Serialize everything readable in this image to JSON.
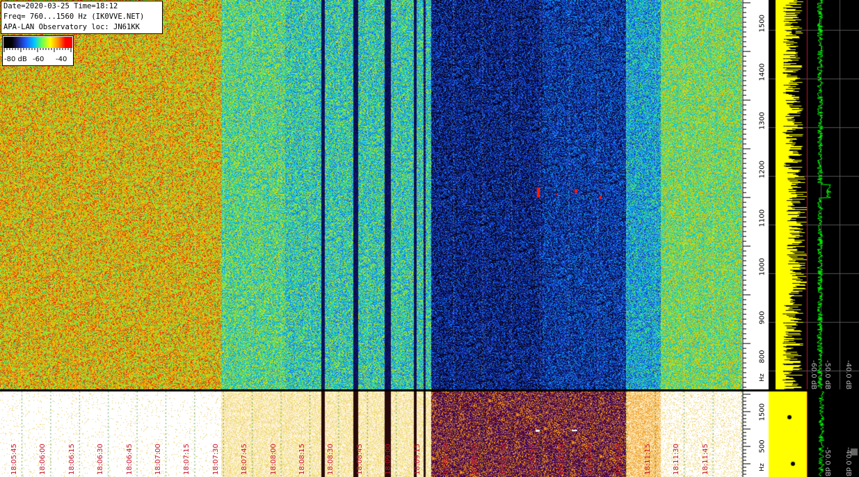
{
  "info": {
    "line1": "Date=2020-03-25 Time=18:12",
    "line2": "Freq= 760...1560 Hz (IK0VVE.NET)",
    "line3": "APA-LAN Observatory loc: JN61KK"
  },
  "colorbar": {
    "labels": [
      "-80 dB",
      "-60",
      "-40"
    ]
  },
  "freq_axis": {
    "unit": "Hz",
    "ticks": [
      "1500",
      "1400",
      "1300",
      "1200",
      "1100",
      "1000",
      "900",
      "800"
    ]
  },
  "lower_freq_axis": {
    "ticks": [
      "1500",
      "500"
    ],
    "unit": "Hz"
  },
  "spectrum": {
    "labels": [
      "-60.0 dB",
      "-50.0 dB",
      "-40.0 dB"
    ],
    "lower_labels": [
      "-50.0 dB",
      "-40.0 dB"
    ]
  },
  "time_axis": {
    "labels": [
      "18:05:45",
      "18:06:00",
      "18:06:15",
      "18:06:30",
      "18:06:45",
      "18:07:00",
      "18:07:15",
      "18:07:30",
      "18:07:45",
      "18:08:00",
      "18:08:15",
      "18:08:30",
      "18:08:45",
      "18:09:00",
      "18:09:15",
      "18:09:30",
      "18:09:45",
      "18:10:00",
      "18:10:15",
      "18:10:30",
      "18:10:45",
      "18:11:00",
      "18:11:15",
      "18:11:30",
      "18:11:45"
    ]
  },
  "colors": {
    "time_label": "#c8102e",
    "spectrum_fill": "#ffff00",
    "spectrum_line": "#00ff00",
    "marker": "#c8102e"
  }
}
